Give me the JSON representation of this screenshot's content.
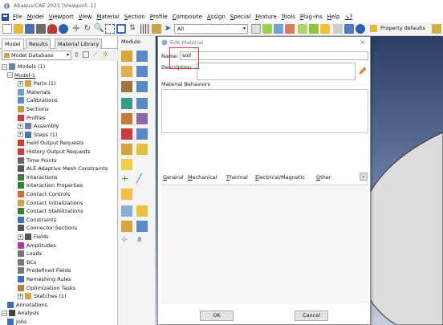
{
  "window": {
    "title": "Abaqus/CAE 2021 [Viewport: 1]"
  },
  "menubar": [
    "File",
    "Model",
    "Viewport",
    "View",
    "Material",
    "Section",
    "Profile",
    "Composite",
    "Assign",
    "Special",
    "Feature",
    "Tools",
    "Plug-ins",
    "Help",
    "↘?"
  ],
  "toolbar": {
    "filter_value": "All",
    "property_value": "Property defaults"
  },
  "left_panel": {
    "tabs": [
      "Model",
      "Results",
      "Material Library"
    ],
    "database_select": "Model Database",
    "tree": [
      {
        "label": "Models (1)",
        "exp": "−",
        "icon": "models"
      },
      {
        "label": "Model-1",
        "exp": "−",
        "icon": "none",
        "underline": true
      },
      {
        "label": "Parts (1)",
        "exp": "+",
        "icon": "parts"
      },
      {
        "label": "Materials",
        "exp": "",
        "icon": "materials"
      },
      {
        "label": "Calibrations",
        "exp": "",
        "icon": "calibrations"
      },
      {
        "label": "Sections",
        "exp": "",
        "icon": "sections"
      },
      {
        "label": "Profiles",
        "exp": "",
        "icon": "profiles"
      },
      {
        "label": "Assembly",
        "exp": "+",
        "icon": "assembly"
      },
      {
        "label": "Steps (1)",
        "exp": "+",
        "icon": "steps"
      },
      {
        "label": "Field Output Requests",
        "exp": "",
        "icon": "field-output"
      },
      {
        "label": "History Output Requests",
        "exp": "",
        "icon": "history-output"
      },
      {
        "label": "Time Points",
        "exp": "",
        "icon": "time-points"
      },
      {
        "label": "ALE Adaptive Mesh Constraints",
        "exp": "",
        "icon": "ale"
      },
      {
        "label": "Interactions",
        "exp": "",
        "icon": "interactions"
      },
      {
        "label": "Interaction Properties",
        "exp": "",
        "icon": "interaction-properties"
      },
      {
        "label": "Contact Controls",
        "exp": "",
        "icon": "contact-controls"
      },
      {
        "label": "Contact Initializations",
        "exp": "",
        "icon": "contact-init"
      },
      {
        "label": "Contact Stabilizations",
        "exp": "",
        "icon": "contact-stab"
      },
      {
        "label": "Constraints",
        "exp": "",
        "icon": "constraints"
      },
      {
        "label": "Connector Sections",
        "exp": "",
        "icon": "connector"
      },
      {
        "label": "Fields",
        "exp": "+",
        "icon": "fields"
      },
      {
        "label": "Amplitudes",
        "exp": "",
        "icon": "amplitudes"
      },
      {
        "label": "Loads",
        "exp": "",
        "icon": "loads"
      },
      {
        "label": "BCs",
        "exp": "",
        "icon": "bcs"
      },
      {
        "label": "Predefined Fields",
        "exp": "",
        "icon": "predefined"
      },
      {
        "label": "Remeshing Rules",
        "exp": "",
        "icon": "remeshing"
      },
      {
        "label": "Optimization Tasks",
        "exp": "",
        "icon": "optimization"
      },
      {
        "label": "Sketches (1)",
        "exp": "+",
        "icon": "sketches"
      },
      {
        "label": "Annotations",
        "exp": "",
        "icon": "annotations"
      },
      {
        "label": "Analysis",
        "exp": "−",
        "icon": "analysis"
      },
      {
        "label": "Jobs",
        "exp": "",
        "icon": "jobs"
      }
    ]
  },
  "module_label": "Module:",
  "dialog": {
    "title": "Edit Material",
    "name_label": "Name:",
    "name_value": "soil",
    "description_label": "Description:",
    "description_value": "",
    "behaviors_label": "Material Behaviors",
    "menu_tabs": [
      "General",
      "Mechanical",
      "Thermal",
      "Electrical/Magnetic",
      "Other"
    ],
    "ok_label": "OK",
    "cancel_label": "Cancel"
  },
  "colors": {
    "highlight_box": "#e0342a",
    "viewport_top": "#2a3f63",
    "viewport_bottom": "#c5cedf"
  }
}
